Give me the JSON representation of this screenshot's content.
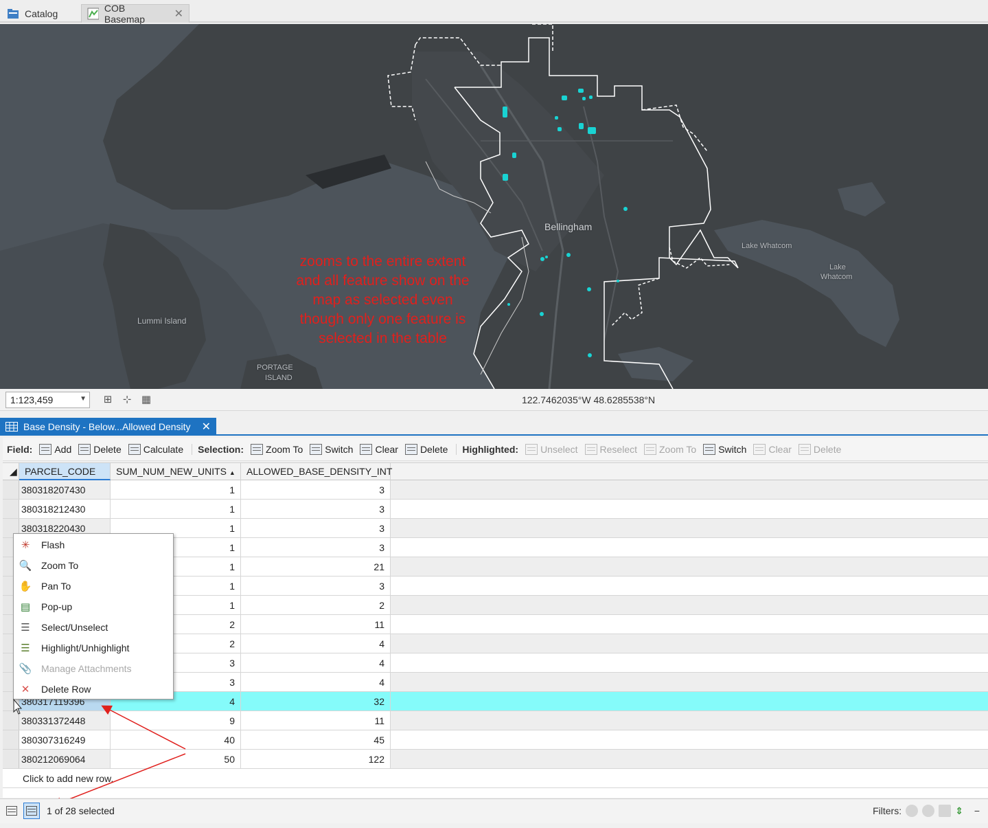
{
  "top_tabs": [
    {
      "label": "Catalog",
      "icon": "catalog-icon"
    },
    {
      "label": "COB Basemap",
      "icon": "map-icon",
      "active": true
    }
  ],
  "map": {
    "labels": {
      "city": "Bellingham",
      "lake1": "Lake Whatcom",
      "lake2a": "Lake",
      "lake2b": "Whatcom",
      "island": "Lummi Island",
      "portage1": "PORTAGE",
      "portage2": "ISLAND"
    },
    "annotation": [
      "zooms to the entire extent",
      "and all feature show on the",
      "map as selected even",
      "though only one feature is",
      "selected in the table"
    ],
    "colors": {
      "background": "#3f4346",
      "water": "#4a5158",
      "boundary": "#ffffff",
      "feature": "#19d3d3",
      "annotation": "#e0201d"
    }
  },
  "map_status": {
    "scale": "1:123,459",
    "coordinates": "122.7462035°W 48.6285538°N"
  },
  "table_tab": {
    "label": "Base Density - Below...Allowed Density",
    "close": "✕"
  },
  "toolbar": {
    "field_label": "Field:",
    "field_buttons": [
      "Add",
      "Delete",
      "Calculate"
    ],
    "selection_label": "Selection:",
    "selection_buttons": [
      "Zoom To",
      "Switch",
      "Clear",
      "Delete"
    ],
    "highlighted_label": "Highlighted:",
    "highlighted_buttons": [
      "Unselect",
      "Reselect",
      "Zoom To",
      "Switch",
      "Clear",
      "Delete"
    ]
  },
  "grid": {
    "columns": [
      "PARCEL_CODE",
      "SUM_NUM_NEW_UNITS",
      "ALLOWED_BASE_DENSITY_INT"
    ],
    "rows": [
      {
        "parcel": "380318207430",
        "units": "1",
        "density": "3"
      },
      {
        "parcel": "380318212430",
        "units": "1",
        "density": "3"
      },
      {
        "parcel": "380318220430",
        "units": "1",
        "density": "3"
      },
      {
        "parcel": "",
        "units": "1",
        "density": "3"
      },
      {
        "parcel": "",
        "units": "1",
        "density": "21"
      },
      {
        "parcel": "",
        "units": "1",
        "density": "3"
      },
      {
        "parcel": "",
        "units": "1",
        "density": "2"
      },
      {
        "parcel": "",
        "units": "2",
        "density": "11"
      },
      {
        "parcel": "",
        "units": "2",
        "density": "4"
      },
      {
        "parcel": "",
        "units": "3",
        "density": "4"
      },
      {
        "parcel": "",
        "units": "3",
        "density": "4"
      },
      {
        "parcel": "380317119396",
        "units": "4",
        "density": "32"
      },
      {
        "parcel": "380331372448",
        "units": "9",
        "density": "11"
      },
      {
        "parcel": "380307316249",
        "units": "40",
        "density": "45"
      },
      {
        "parcel": "380212069064",
        "units": "50",
        "density": "122"
      }
    ],
    "add_row": "Click to add new row."
  },
  "context_menu": [
    {
      "label": "Flash",
      "icon": "flash-icon",
      "glyph": "✳"
    },
    {
      "label": "Zoom To",
      "icon": "magnifier-icon",
      "glyph": "🔍"
    },
    {
      "label": "Pan To",
      "icon": "hand-icon",
      "glyph": "✋"
    },
    {
      "label": "Pop-up",
      "icon": "popup-icon",
      "glyph": "▤"
    },
    {
      "label": "Select/Unselect",
      "icon": "select-icon",
      "glyph": "☰"
    },
    {
      "label": "Highlight/Unhighlight",
      "icon": "highlight-icon",
      "glyph": "☰"
    },
    {
      "label": "Manage Attachments",
      "icon": "paperclip-icon",
      "glyph": "📎",
      "disabled": true
    },
    {
      "label": "Delete Row",
      "icon": "delete-x-icon",
      "glyph": "✕"
    }
  ],
  "status": {
    "selection": "1 of 28 selected",
    "filters_label": "Filters:"
  }
}
